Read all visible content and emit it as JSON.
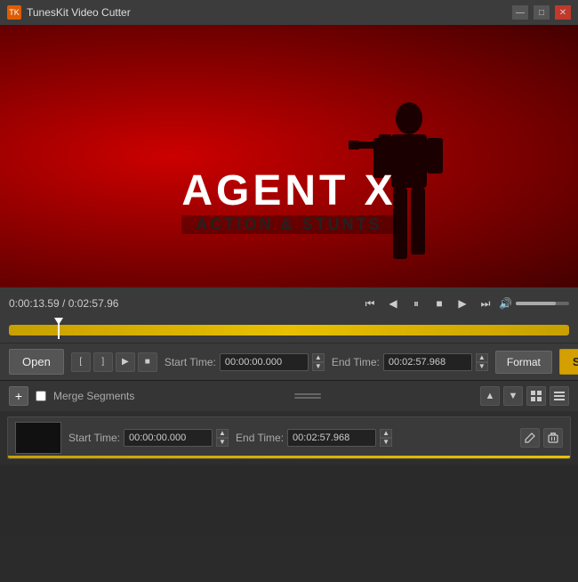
{
  "titlebar": {
    "icon_label": "TK",
    "title": "TunesKit Video Cutter",
    "minimize_label": "—",
    "maximize_label": "□",
    "close_label": "✕"
  },
  "video": {
    "main_title": "AGENT X",
    "subtitle": "ACTION & STUNTS",
    "current_time": "0:00:13.59",
    "total_time": "0:02:57.96",
    "time_display": "0:00:13.59 / 0:02:57.96"
  },
  "controls": {
    "btn_step_back": "⏮",
    "btn_prev": "◀",
    "btn_pause": "⏸",
    "btn_stop": "■",
    "btn_play": "▶",
    "btn_fast_forward": "⏭",
    "volume_icon": "🔊"
  },
  "toolbar": {
    "open_label": "Open",
    "start_label": "Start",
    "format_label": "Format",
    "start_time_label": "Start Time:",
    "end_time_label": "End Time:",
    "start_time_value": "00:00:00.000",
    "end_time_value": "00:02:57.968",
    "btn_mark_in": "[",
    "btn_mark_out": "]",
    "btn_preview": "▶",
    "btn_stop_preview": "■"
  },
  "segments": {
    "add_label": "+",
    "merge_label": "Merge Segments",
    "up_label": "▲",
    "down_label": "▼",
    "thumbnail_label": "⊞",
    "list_label": "≡",
    "row": {
      "start_time_label": "Start Time:",
      "end_time_label": "End Time:",
      "start_time_value": "00:00:00.000",
      "end_time_value": "00:02:57.968",
      "edit_label": "✎",
      "delete_label": "🗑"
    }
  }
}
